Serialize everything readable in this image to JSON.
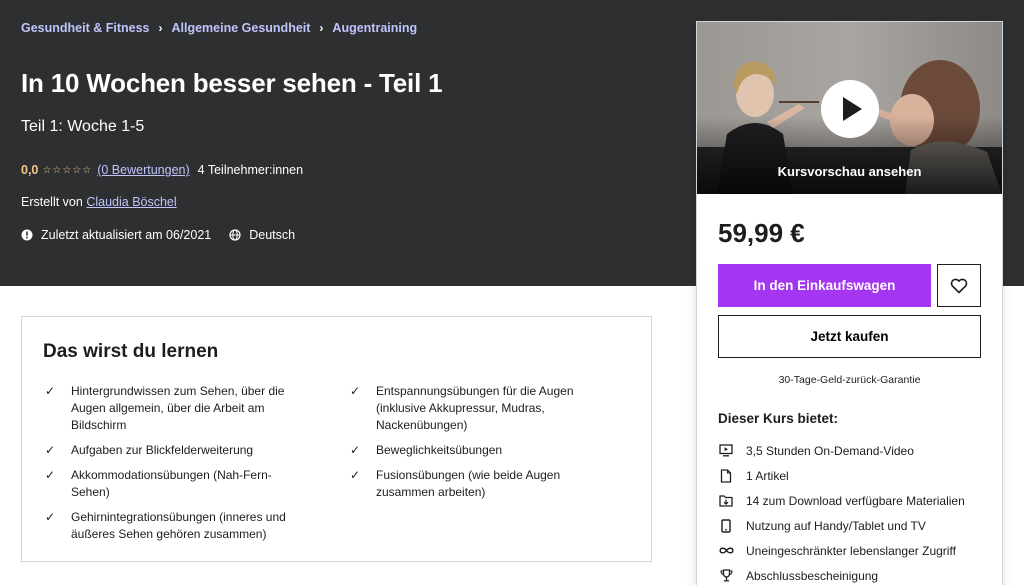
{
  "breadcrumb": [
    "Gesundheit & Fitness",
    "Allgemeine Gesundheit",
    "Augentraining"
  ],
  "breadcrumb_separator": "›",
  "course": {
    "title": "In 10 Wochen besser sehen - Teil 1",
    "subtitle": "Teil 1: Woche 1-5",
    "rating_value": "0,0",
    "stars": "☆☆☆☆☆",
    "rating_count": "(0 Bewertungen)",
    "participants": "4 Teilnehmer:innen",
    "created_by_label": "Erstellt von",
    "author": "Claudia Böschel",
    "last_updated": "Zuletzt aktualisiert am 06/2021",
    "language": "Deutsch"
  },
  "learn": {
    "title": "Das wirst du lernen",
    "check_glyph": "✓",
    "left": [
      "Hintergrundwissen zum Sehen, über die Augen allgemein, über die Arbeit am Bildschirm",
      "Aufgaben zur Blickfelderweiterung",
      "Akkommodationsübungen (Nah-Fern-Sehen)",
      "Gehirnintegrationsübungen (inneres und äußeres Sehen gehören zusammen)"
    ],
    "right": [
      "Entspannungsübungen für die Augen (inklusive Akkupressur, Mudras, Nackenübungen)",
      "Beweglichkeitsübungen",
      "Fusionsübungen (wie beide Augen zusammen arbeiten)"
    ]
  },
  "sidebar": {
    "preview_label": "Kursvorschau ansehen",
    "price": "59,99 €",
    "cart_button": "In den Einkaufswagen",
    "buy_button": "Jetzt kaufen",
    "guarantee": "30-Tage-Geld-zurück-Garantie",
    "includes_title": "Dieser Kurs bietet:",
    "includes": [
      {
        "icon": "video-icon",
        "text": "3,5 Stunden On-Demand-Video"
      },
      {
        "icon": "file-icon",
        "text": "1 Artikel"
      },
      {
        "icon": "download-icon",
        "text": "14 zum Download verfügbare Materialien"
      },
      {
        "icon": "mobile-icon",
        "text": "Nutzung auf Handy/Tablet und TV"
      },
      {
        "icon": "infinity-icon",
        "text": "Uneingeschränkter lebenslanger Zugriff"
      },
      {
        "icon": "trophy-icon",
        "text": "Abschlussbescheinigung"
      }
    ]
  },
  "colors": {
    "hero_bg": "#2d2f31",
    "link_accent": "#c0c4fc",
    "star": "#f3ca8c",
    "purple": "#a435f0"
  }
}
